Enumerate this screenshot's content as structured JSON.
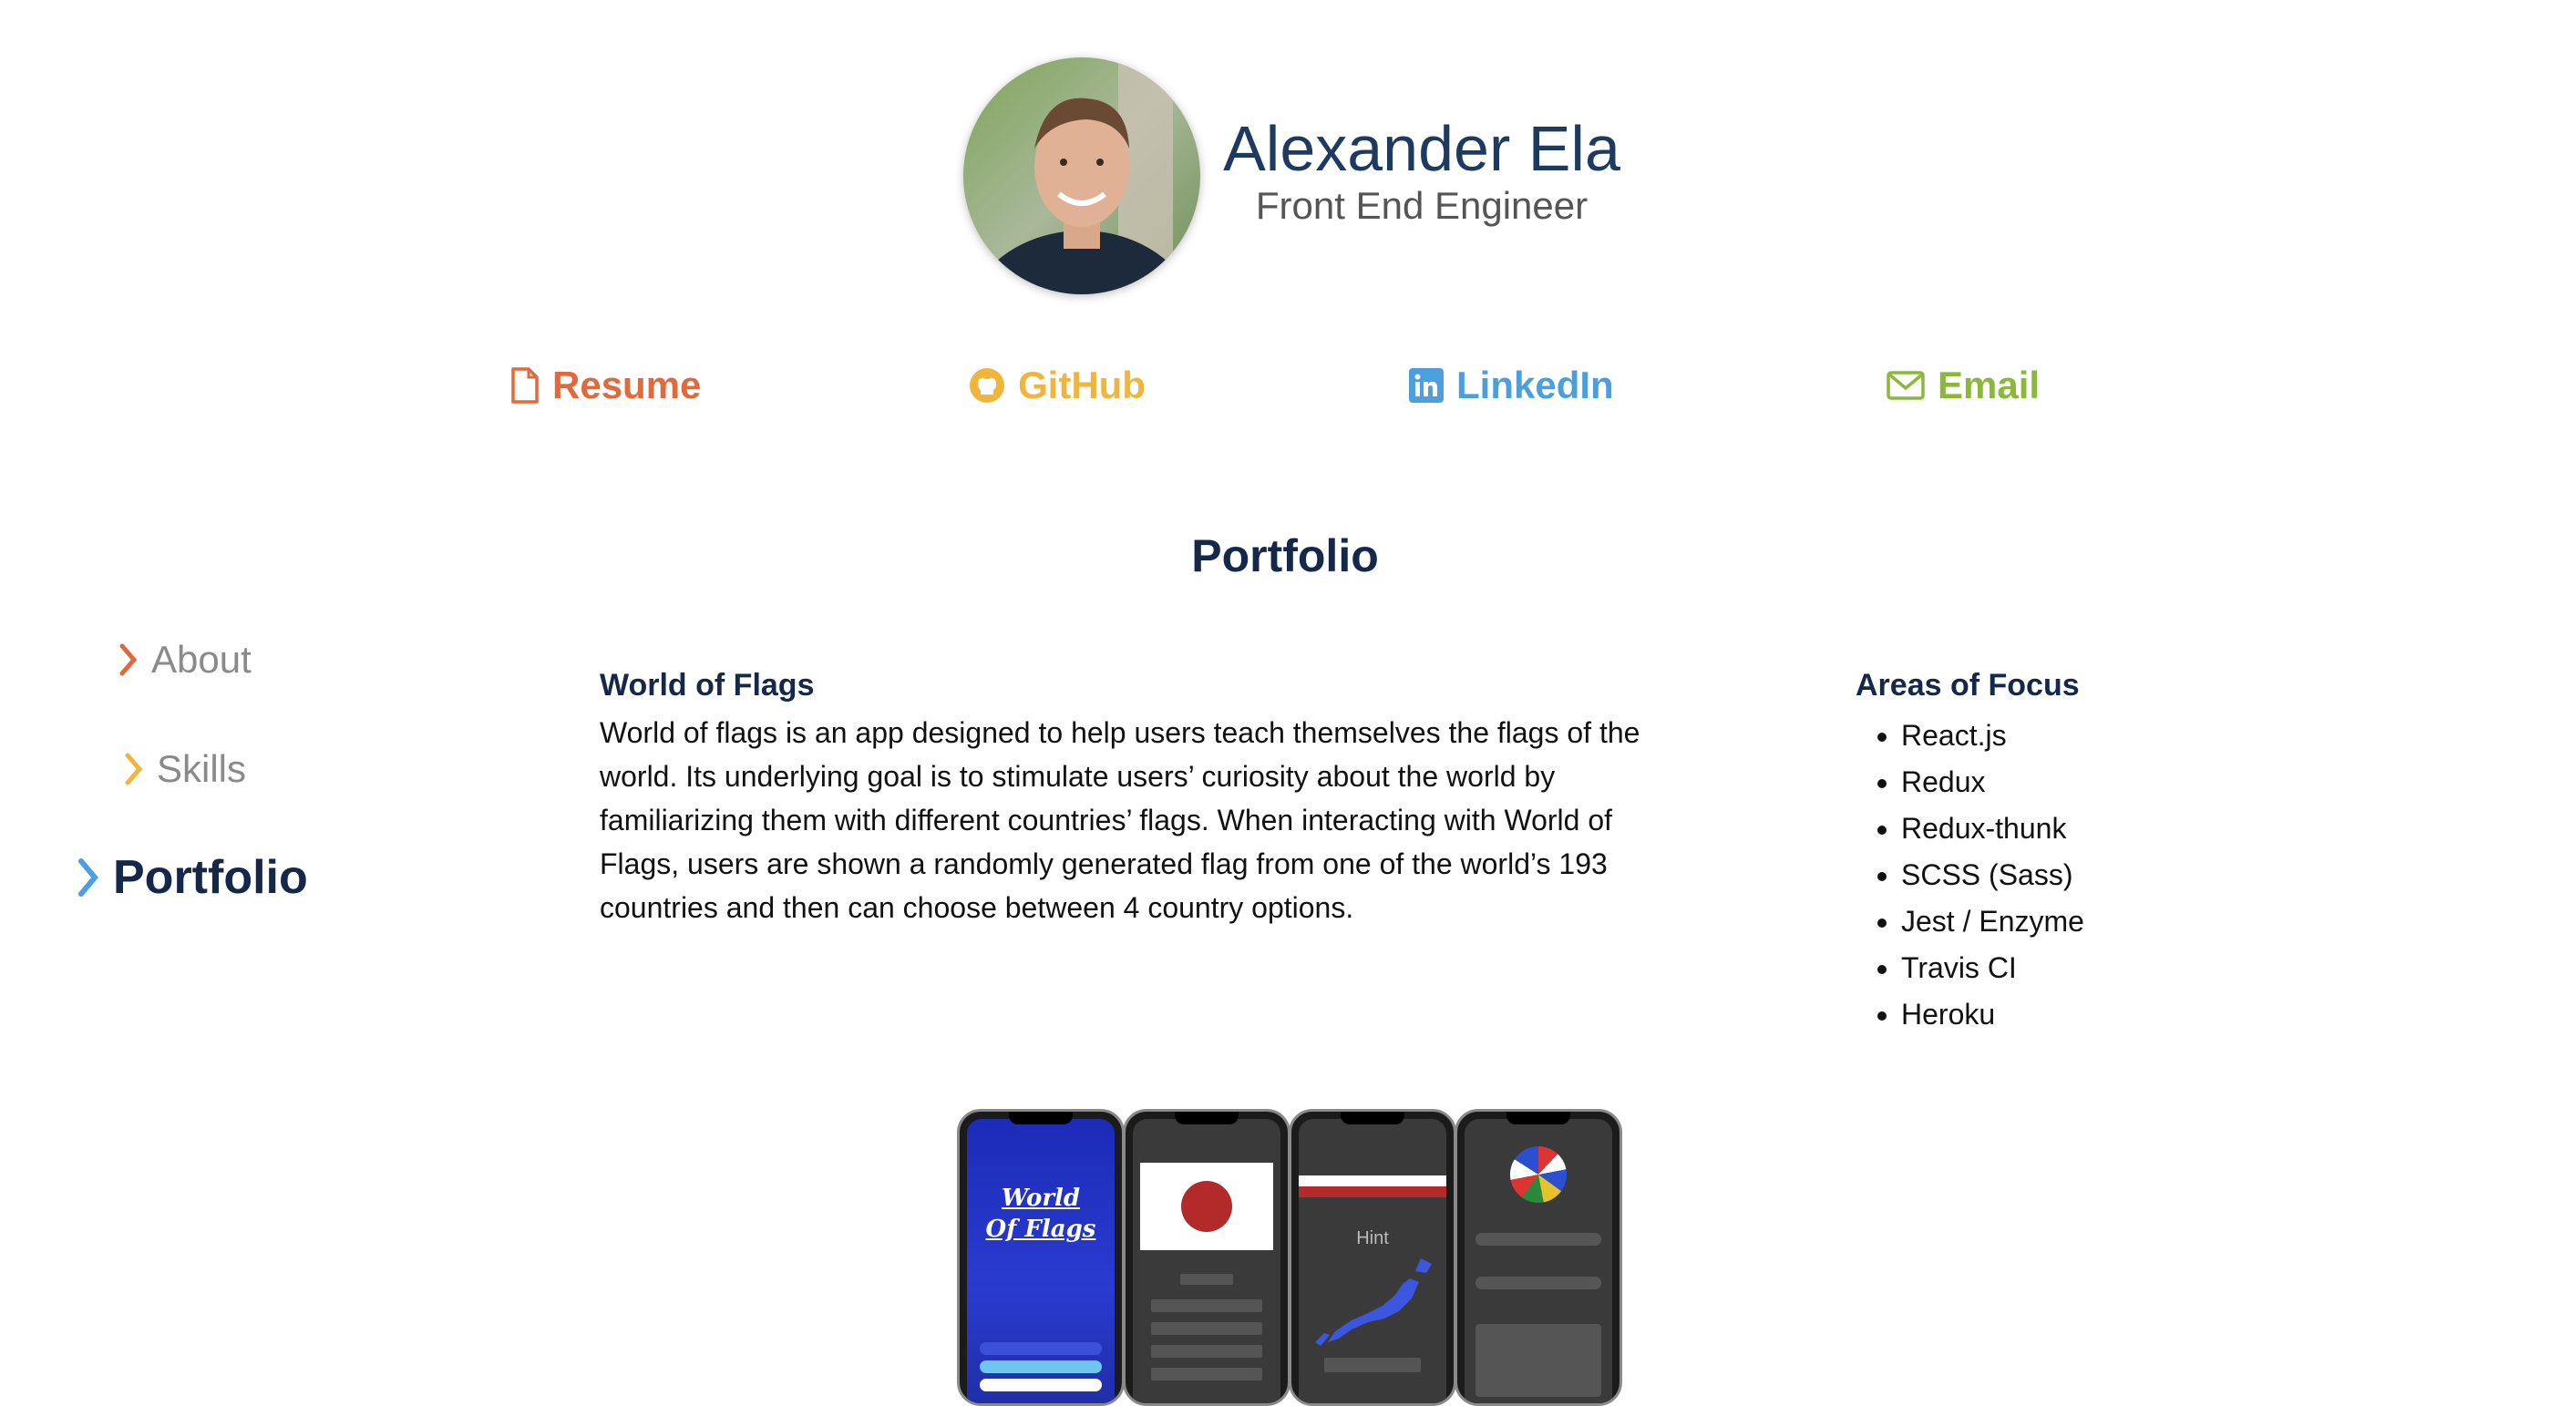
{
  "header": {
    "name": "Alexander Ela",
    "role": "Front End Engineer"
  },
  "nav": {
    "resume": "Resume",
    "github": "GitHub",
    "linkedin": "LinkedIn",
    "email": "Email"
  },
  "section_title": "Portfolio",
  "sidebar": {
    "items": [
      {
        "label": "About",
        "active": false
      },
      {
        "label": "Skills",
        "active": false
      },
      {
        "label": "Portfolio",
        "active": true
      }
    ]
  },
  "project": {
    "title": "World of Flags",
    "description": "World of flags is an app designed to help users teach themselves the flags of the world. Its underlying goal is to stimulate users’ curiosity about the world by familiarizing them with different countries’ flags. When interacting with World of Flags, users are shown a randomly generated flag from one of the world’s 193 countries and then can choose between 4 country options."
  },
  "focus": {
    "title": "Areas of Focus",
    "items": [
      "React.js",
      "Redux",
      "Redux-thunk",
      "SCSS (Sass)",
      "Jest / Enzyme",
      "Travis CI",
      "Heroku"
    ]
  },
  "screens": {
    "splash_title_1": "World",
    "splash_title_2": "Of Flags",
    "hint": "Hint"
  },
  "colors": {
    "resume": "#e06a3b",
    "github": "#f2b53c",
    "linkedin": "#4a9fdc",
    "email": "#8ab83c",
    "navy": "#16284a",
    "muted": "#8a8a8a"
  }
}
